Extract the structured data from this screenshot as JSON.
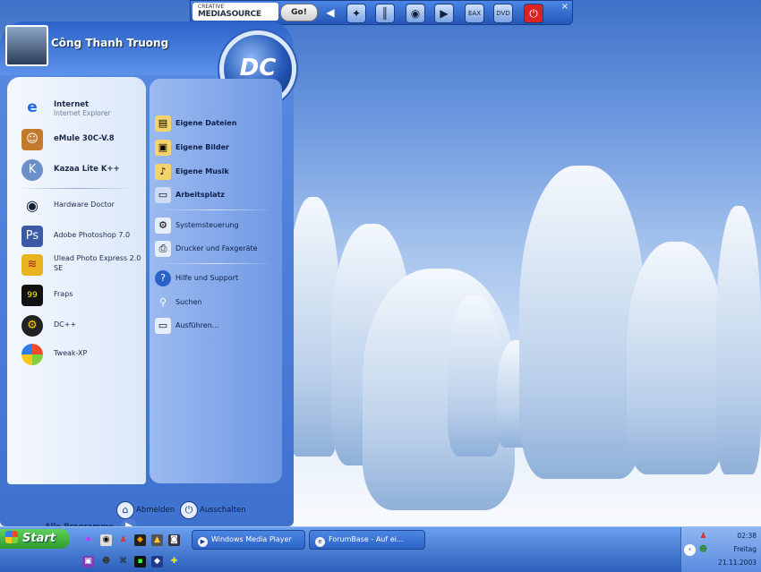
{
  "toolbar": {
    "brand_top": "CREATIVE",
    "brand_main": "MEDIASOURCE",
    "go_label": "Go!",
    "icons": [
      "back-icon",
      "skin-icon",
      "equalizer-icon",
      "disc-icon",
      "play-icon",
      "eax-icon",
      "dvd-icon",
      "power-icon"
    ],
    "close_glyph": "×"
  },
  "user": {
    "name": "Công Thanh Truong"
  },
  "logo": {
    "text": "DC"
  },
  "pinned": [
    {
      "label": "Internet",
      "sub": "Internet Explorer",
      "icon": "ie-icon",
      "bold": true
    },
    {
      "label": "eMule 30C-V.8",
      "icon": "emule-icon",
      "bold": true
    },
    {
      "label": "Kazaa Lite K++",
      "icon": "kazaa-icon",
      "bold": true
    }
  ],
  "recent": [
    {
      "label": "Hardware Doctor",
      "icon": "eye-icon"
    },
    {
      "label": "Adobe Photoshop 7.0",
      "icon": "photoshop-icon"
    },
    {
      "label": "Ulead Photo Express 2.0",
      "label2": "SE",
      "icon": "ulead-icon"
    },
    {
      "label": "Fraps",
      "icon": "fraps-icon"
    },
    {
      "label": "DC++",
      "icon": "dcpp-icon"
    },
    {
      "label": "Tweak-XP",
      "icon": "tweakxp-icon"
    }
  ],
  "all_programs": "Alle Programme",
  "places": [
    {
      "label": "Eigene Dateien",
      "icon": "folder-icon",
      "bold": true
    },
    {
      "label": "Eigene Bilder",
      "icon": "folder-pictures-icon",
      "bold": true
    },
    {
      "label": "Eigene Musik",
      "icon": "folder-music-icon",
      "bold": true
    },
    {
      "label": "Arbeitsplatz",
      "icon": "computer-icon",
      "bold": true
    },
    {
      "label": "Systemsteuerung",
      "icon": "control-panel-icon"
    },
    {
      "label": "Drucker und Faxgeräte",
      "icon": "printer-icon"
    },
    {
      "label": "Hilfe und Support",
      "icon": "help-icon"
    },
    {
      "label": "Suchen",
      "icon": "search-icon"
    },
    {
      "label": "Ausführen...",
      "icon": "run-icon"
    }
  ],
  "footer": {
    "logoff": "Abmelden",
    "shutdown": "Ausschalten"
  },
  "taskbar": {
    "start_label": "Start",
    "tasks": [
      {
        "label": "Windows Media Player",
        "icon": "media-player-icon"
      },
      {
        "label": "ForumBase - Auf ei...",
        "icon": "ie-icon"
      }
    ]
  },
  "tray": {
    "time": "02:38",
    "day": "Freitag",
    "date": "21.11.2003"
  }
}
